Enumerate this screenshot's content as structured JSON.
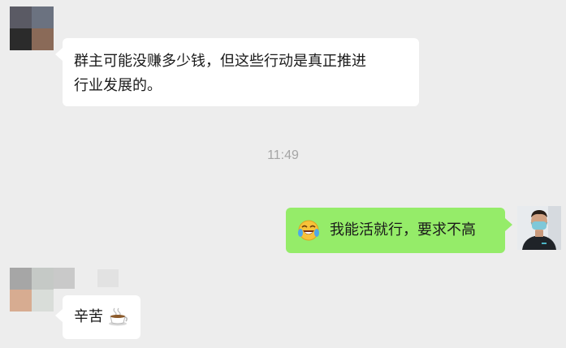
{
  "chat": {
    "messages": [
      {
        "side": "left",
        "lines": [
          "群主可能没赚多少钱，但这些行动是真正推进",
          "行业发展的。"
        ]
      },
      {
        "timestamp": "11:49"
      },
      {
        "side": "right",
        "emoji": "laughing-crying-face-icon",
        "text": "我能活就行，要求不高"
      },
      {
        "side": "left",
        "text": "辛苦",
        "emoji": "coffee-cup-icon"
      }
    ]
  },
  "colors": {
    "background": "#ededed",
    "bubble_left": "#ffffff",
    "bubble_right": "#95ec69",
    "timestamp_text": "#a5a5a5"
  }
}
